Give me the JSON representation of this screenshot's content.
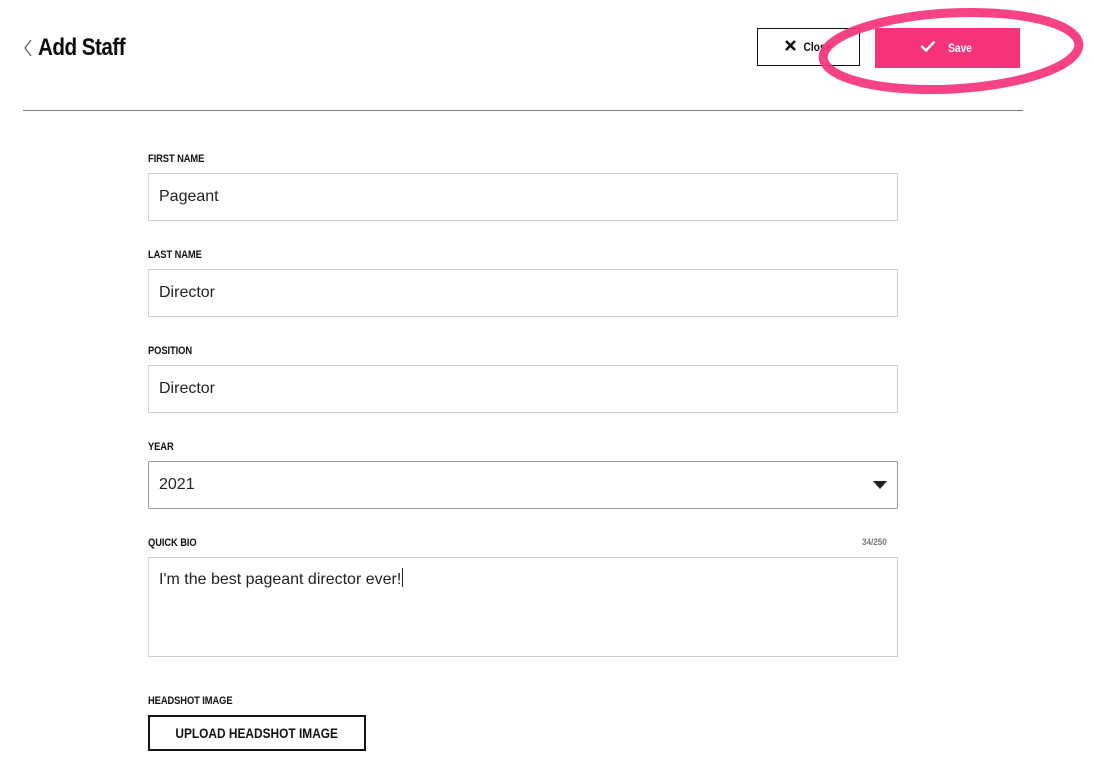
{
  "header": {
    "title": "Add Staff",
    "close_label": "Close",
    "save_label": "Save"
  },
  "form": {
    "first_name": {
      "label": "FIRST NAME",
      "value": "Pageant"
    },
    "last_name": {
      "label": "LAST NAME",
      "value": "Director"
    },
    "position": {
      "label": "POSITION",
      "value": "Director"
    },
    "year": {
      "label": "YEAR",
      "selected": "2021"
    },
    "quick_bio": {
      "label": "QUICK BIO",
      "counter": "34/250",
      "value": "I'm the best pageant director ever!"
    },
    "headshot": {
      "label": "HEADSHOT IMAGE",
      "button_label": "UPLOAD HEADSHOT IMAGE"
    }
  },
  "colors": {
    "accent": "#f5337b",
    "highlight_ring": "#f5337b",
    "border": "#cfcfcf",
    "divider": "#7a7a7a"
  },
  "icons": {
    "back": "chevron-left-icon",
    "close": "close-icon",
    "save": "check-icon",
    "select": "caret-down-icon"
  }
}
